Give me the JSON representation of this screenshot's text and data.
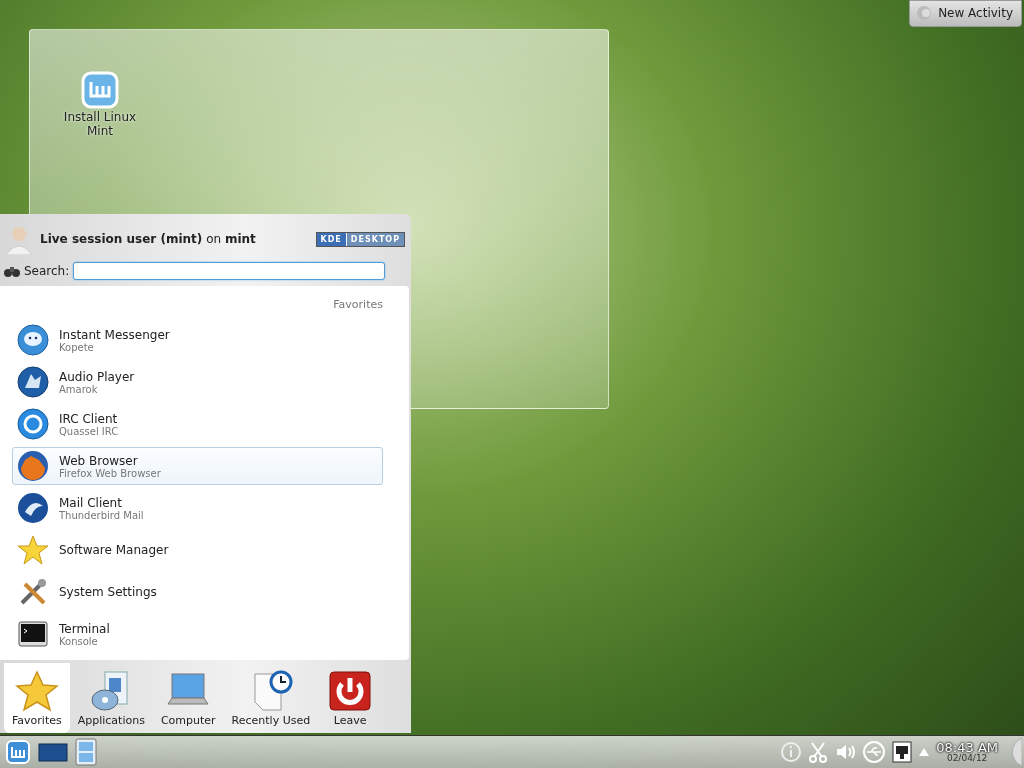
{
  "activity_button": {
    "label": "New Activity"
  },
  "desktop_icons": [
    {
      "label": "Install Linux Mint"
    }
  ],
  "menu": {
    "header": "**Live session user (mint)** on **mint**",
    "badge": [
      "KDE",
      "DESKTOP"
    ],
    "search": {
      "label": "Search:"
    },
    "section_title": "Favorites",
    "items": [
      {
        "name": "Instant Messenger",
        "description": "Kopete",
        "selected": false
      },
      {
        "name": "Audio Player",
        "description": "Amarok",
        "selected": false
      },
      {
        "name": "IRC Client",
        "description": "Quassel IRC",
        "selected": false
      },
      {
        "name": "Web Browser",
        "description": "Firefox Web Browser",
        "selected": true
      },
      {
        "name": "Mail Client",
        "description": "Thunderbird Mail",
        "selected": false
      },
      {
        "name": "Software Manager",
        "selected": false
      },
      {
        "name": "System Settings",
        "selected": false
      },
      {
        "name": "Terminal",
        "description": "Konsole",
        "selected": false
      }
    ],
    "tabs": [
      {
        "label": "Favorites",
        "selected": true
      },
      {
        "label": "Applications",
        "selected": false
      },
      {
        "label": "Computer",
        "selected": false
      },
      {
        "label": "Recently Used",
        "selected": false
      },
      {
        "label": "Leave",
        "selected": false
      }
    ]
  },
  "taskbar": {
    "time": "08:43 AM",
    "date": "02/04/12"
  }
}
